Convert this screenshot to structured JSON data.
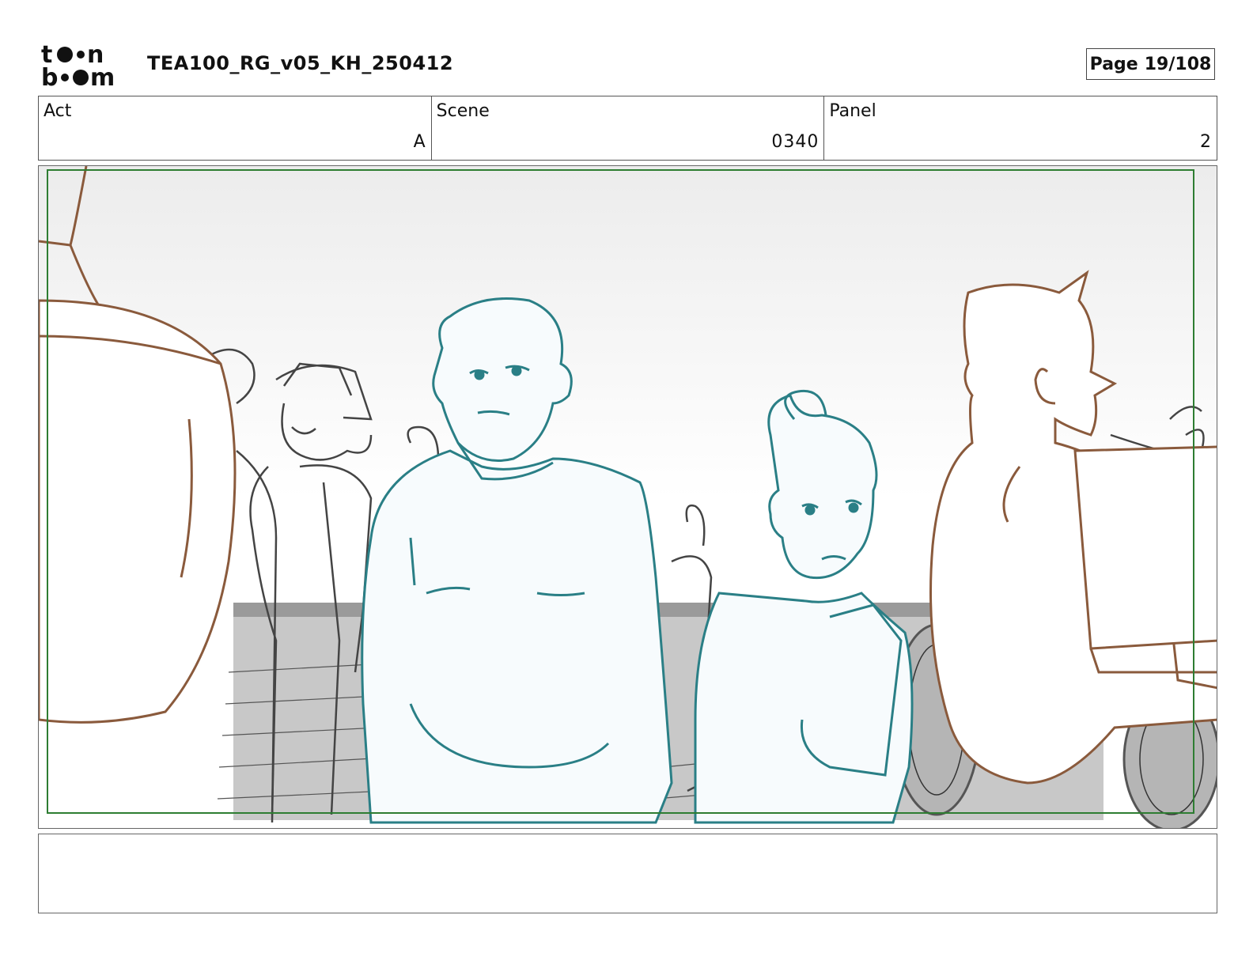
{
  "header": {
    "logo_text": "toon boom",
    "document_title": "TEA100_RG_v05_KH_250412",
    "page_label": "Page",
    "page_value": "19/108"
  },
  "info": {
    "act": {
      "label": "Act",
      "value": "A"
    },
    "scene": {
      "label": "Scene",
      "value": "0340"
    },
    "panel": {
      "label": "Panel",
      "value": "2"
    }
  },
  "colors": {
    "safe_frame": "#2e7d32",
    "foreground_characters": "#8a5a3c",
    "main_characters": "#2a7f86",
    "background_crowd": "#444444",
    "background_fill": "#c8c8c8"
  },
  "notes": {
    "text": ""
  }
}
